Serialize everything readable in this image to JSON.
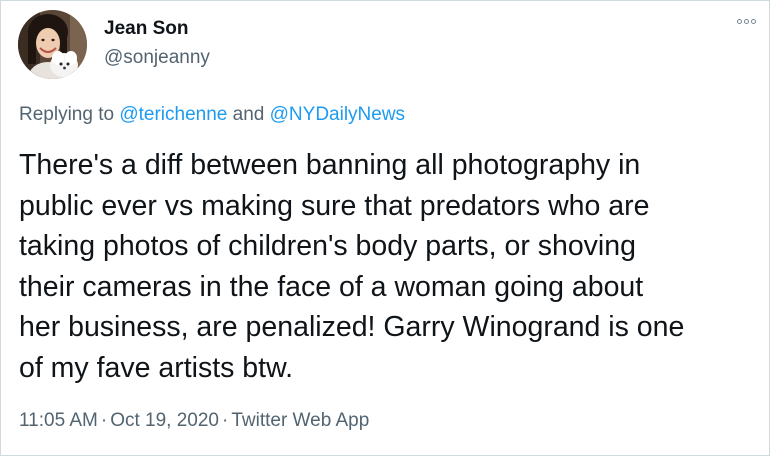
{
  "author": {
    "display_name": "Jean Son",
    "handle": "@sonjeanny"
  },
  "reply": {
    "prefix": "Replying to",
    "mention_1": "@terichenne",
    "joiner": "and",
    "mention_2": "@NYDailyNews"
  },
  "tweet": {
    "lines": [
      "There's a diff between banning all photography in",
      "public ever vs making sure that predators who are",
      "taking photos of children's body parts, or shoving",
      "their cameras in the face of a woman going about",
      "her business, are penalized! Garry Winogrand is one",
      "of my fave artists btw."
    ]
  },
  "meta": {
    "time": "11:05 AM",
    "separator": "·",
    "date": "Oct 19, 2020",
    "source": "Twitter Web App"
  },
  "icons": {
    "more": "more-options-icon",
    "avatar": "profile-photo"
  },
  "colors": {
    "text": "#0f1419",
    "secondary": "#536471",
    "link": "#1d9bf0",
    "border": "#cfd9de"
  }
}
